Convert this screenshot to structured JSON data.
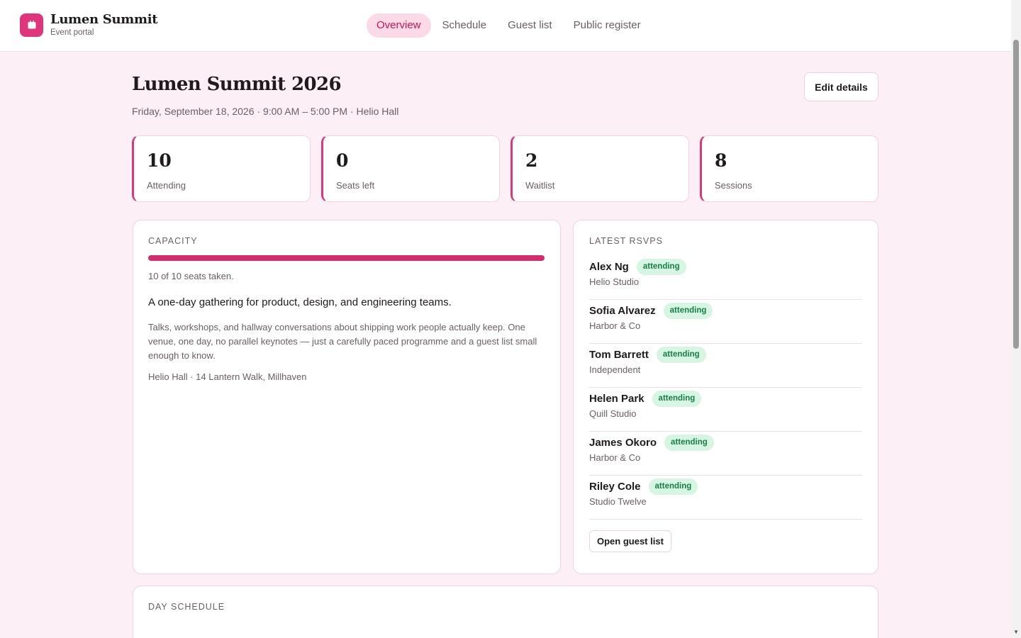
{
  "brand": {
    "name": "Lumen Summit",
    "subtitle": "Event portal",
    "icon": "calendar-icon",
    "accent": "#e0357a"
  },
  "nav": {
    "items": [
      {
        "label": "Overview",
        "active": true
      },
      {
        "label": "Schedule",
        "active": false
      },
      {
        "label": "Guest list",
        "active": false
      },
      {
        "label": "Public register",
        "active": false
      }
    ]
  },
  "event": {
    "title": "Lumen Summit 2026",
    "subtitle": "Friday, September 18, 2026 · 9:00 AM – 5:00 PM · Helio Hall",
    "edit_label": "Edit details"
  },
  "stats": [
    {
      "value": "10",
      "label": "Attending"
    },
    {
      "value": "0",
      "label": "Seats left"
    },
    {
      "value": "2",
      "label": "Waitlist"
    },
    {
      "value": "8",
      "label": "Sessions"
    }
  ],
  "capacity": {
    "heading": "Capacity",
    "fill_fraction": 1.0,
    "note": "10 of 10 seats taken.",
    "lead": "A one-day gathering for product, design, and engineering teams.",
    "body": "Talks, workshops, and hallway conversations about shipping work people actually keep. One venue, one day, no parallel keynotes — just a carefully paced programme and a guest list small enough to know.",
    "address": "Helio Hall · 14 Lantern Walk, Millhaven"
  },
  "rsvps": {
    "heading": "Latest RSVPs",
    "items": [
      {
        "name": "Alex Ng",
        "status": "attending",
        "org": "Helio Studio"
      },
      {
        "name": "Sofia Alvarez",
        "status": "attending",
        "org": "Harbor & Co"
      },
      {
        "name": "Tom Barrett",
        "status": "attending",
        "org": "Independent"
      },
      {
        "name": "Helen Park",
        "status": "attending",
        "org": "Quill Studio"
      },
      {
        "name": "James Okoro",
        "status": "attending",
        "org": "Harbor & Co"
      },
      {
        "name": "Riley Cole",
        "status": "attending",
        "org": "Studio Twelve"
      }
    ],
    "button_label": "Open guest list"
  },
  "schedule": {
    "heading": "Day schedule"
  }
}
